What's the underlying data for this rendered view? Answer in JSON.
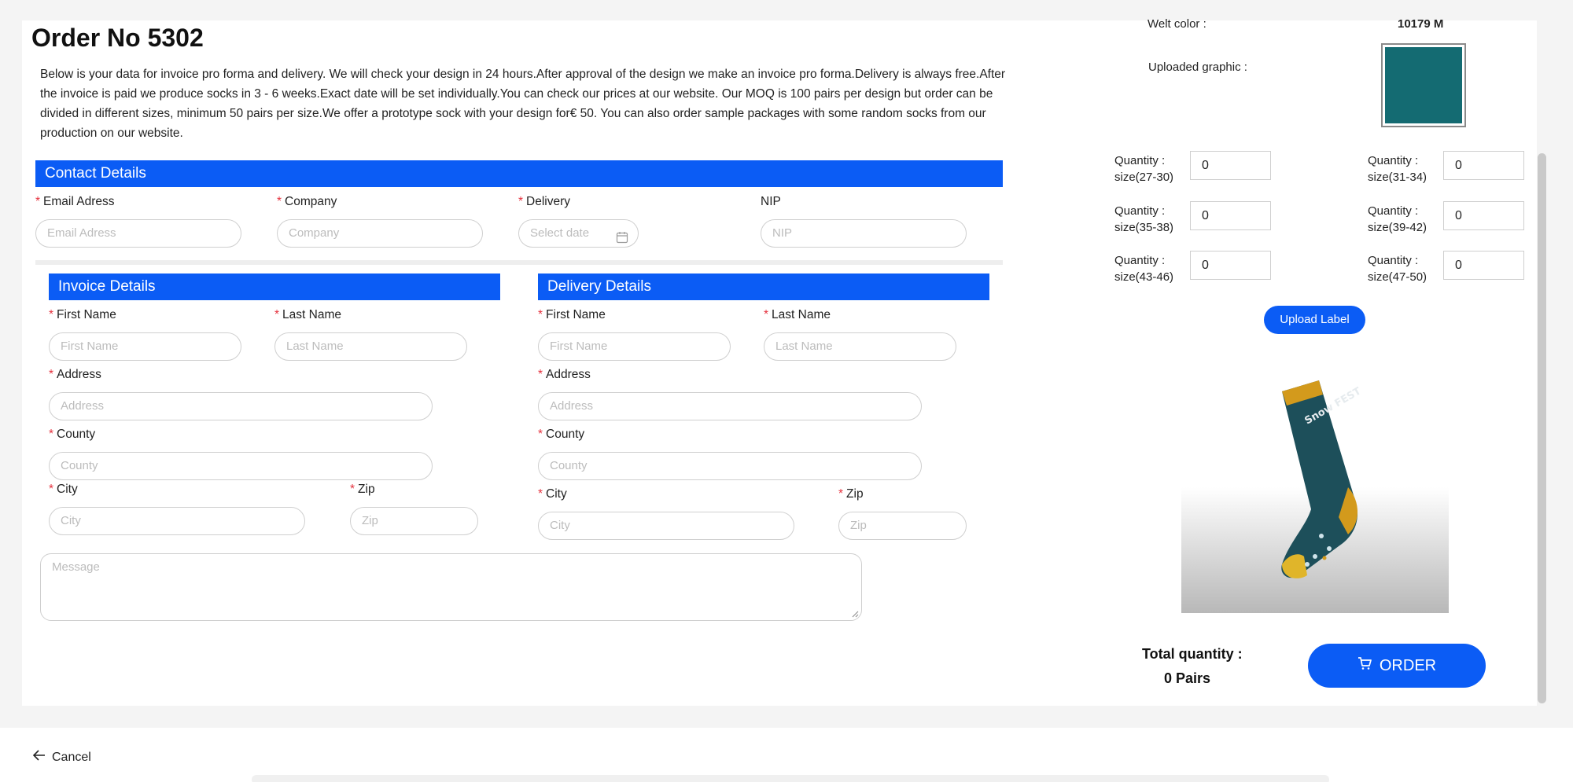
{
  "title": "Order No 5302",
  "description": "Below is your data for invoice pro forma and delivery. We will check your design in 24 hours.After approval of the design we make an invoice pro forma.Delivery is always free.After the invoice is paid we produce socks in 3 - 6 weeks.Exact date will be set individually.You can check our prices at our website. Our MOQ is 100 pairs per design but order can be divided in different sizes, minimum 50 pairs per size.We offer a prototype sock with your design for€ 50. You can also order sample packages with some random socks from our production on our website.",
  "contact": {
    "header": "Contact Details",
    "email_label": "Email Adress",
    "email_placeholder": "Email Adress",
    "company_label": "Company",
    "company_placeholder": "Company",
    "delivery_label": "Delivery",
    "delivery_placeholder": "Select date",
    "nip_label": "NIP",
    "nip_placeholder": "NIP"
  },
  "invoice": {
    "header": "Invoice Details",
    "first_label": "First Name",
    "first_placeholder": "First Name",
    "last_label": "Last Name",
    "last_placeholder": "Last Name",
    "address_label": "Address",
    "address_placeholder": "Address",
    "county_label": "County",
    "county_placeholder": "County",
    "city_label": "City",
    "city_placeholder": "City",
    "zip_label": "Zip",
    "zip_placeholder": "Zip"
  },
  "delivery": {
    "header": "Delivery Details",
    "first_label": "First Name",
    "first_placeholder": "First Name",
    "last_label": "Last Name",
    "last_placeholder": "Last Name",
    "address_label": "Address",
    "address_placeholder": "Address",
    "county_label": "County",
    "county_placeholder": "County",
    "city_label": "City",
    "city_placeholder": "City",
    "zip_label": "Zip",
    "zip_placeholder": "Zip"
  },
  "message_placeholder": "Message",
  "summary": {
    "welt_label": "Welt color :",
    "welt_value": "10179 M",
    "graphic_label": "Uploaded graphic :",
    "graphic_color": "#146b72",
    "quantity_prefix": "Quantity :",
    "sizes": [
      {
        "size": "size(27-30)",
        "value": "0"
      },
      {
        "size": "size(31-34)",
        "value": "0"
      },
      {
        "size": "size(35-38)",
        "value": "0"
      },
      {
        "size": "size(39-42)",
        "value": "0"
      },
      {
        "size": "size(43-46)",
        "value": "0"
      },
      {
        "size": "size(47-50)",
        "value": "0"
      }
    ],
    "upload_label": "Upload Label",
    "sock_text": "Snow FEST",
    "total_label": "Total quantity :",
    "total_value": "0 Pairs",
    "order_label": "ORDER"
  },
  "cancel_label": "Cancel",
  "colors": {
    "accent": "#0b5cf5",
    "required": "#e5323e",
    "sock_body": "#1d4f5a",
    "sock_trim": "#d39a1c"
  }
}
